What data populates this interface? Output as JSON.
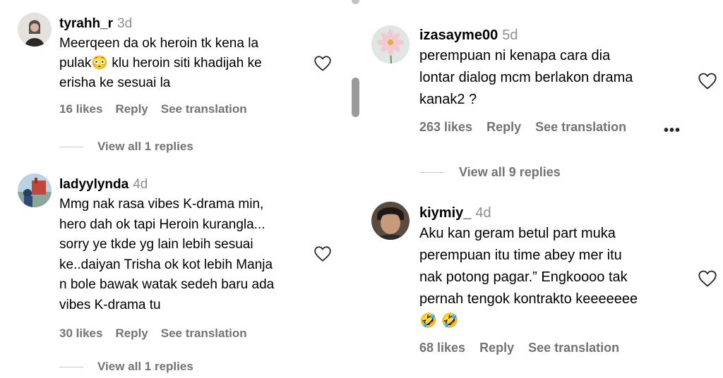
{
  "left_comments": [
    {
      "username": "tyrahh_r",
      "time": "3d",
      "text": "Meerqeen da ok heroin tk kena la\npulak😳 klu heroin siti khadijah ke\nerisha ke sesuai la",
      "likes": "16 likes",
      "reply": "Reply",
      "translate": "See translation",
      "view_replies": "View all 1 replies"
    },
    {
      "username": "ladyylynda",
      "time": "4d",
      "text": "Mmg nak rasa vibes K-drama min,\nhero dah ok tapi Heroin kurangla...\nsorry ye tkde yg lain lebih sesuai\nke..daiyan Trisha ok kot lebih Manja\nn bole bawak watak sedeh baru ada\nvibes K-drama tu",
      "likes": "30 likes",
      "reply": "Reply",
      "translate": "See translation",
      "view_replies": "View all 1 replies"
    }
  ],
  "right_comments": [
    {
      "username": "izasayme00",
      "time": "5d",
      "text": "perempuan ni kenapa cara dia\nlontar dialog mcm berlakon drama\nkanak2 ?",
      "likes": "263 likes",
      "reply": "Reply",
      "translate": "See translation",
      "more": "•••",
      "view_replies": "View all 9 replies"
    },
    {
      "username": "kiymiy_",
      "time": "4d",
      "text": "Aku kan geram betul part muka\nperempuan itu time abey mer itu\nnak potong pagar.” Engkoooo tak\npernah tengok kontrakto keeeeeee\n🤣 🤣",
      "likes": "68 likes",
      "reply": "Reply",
      "translate": "See translation"
    }
  ]
}
